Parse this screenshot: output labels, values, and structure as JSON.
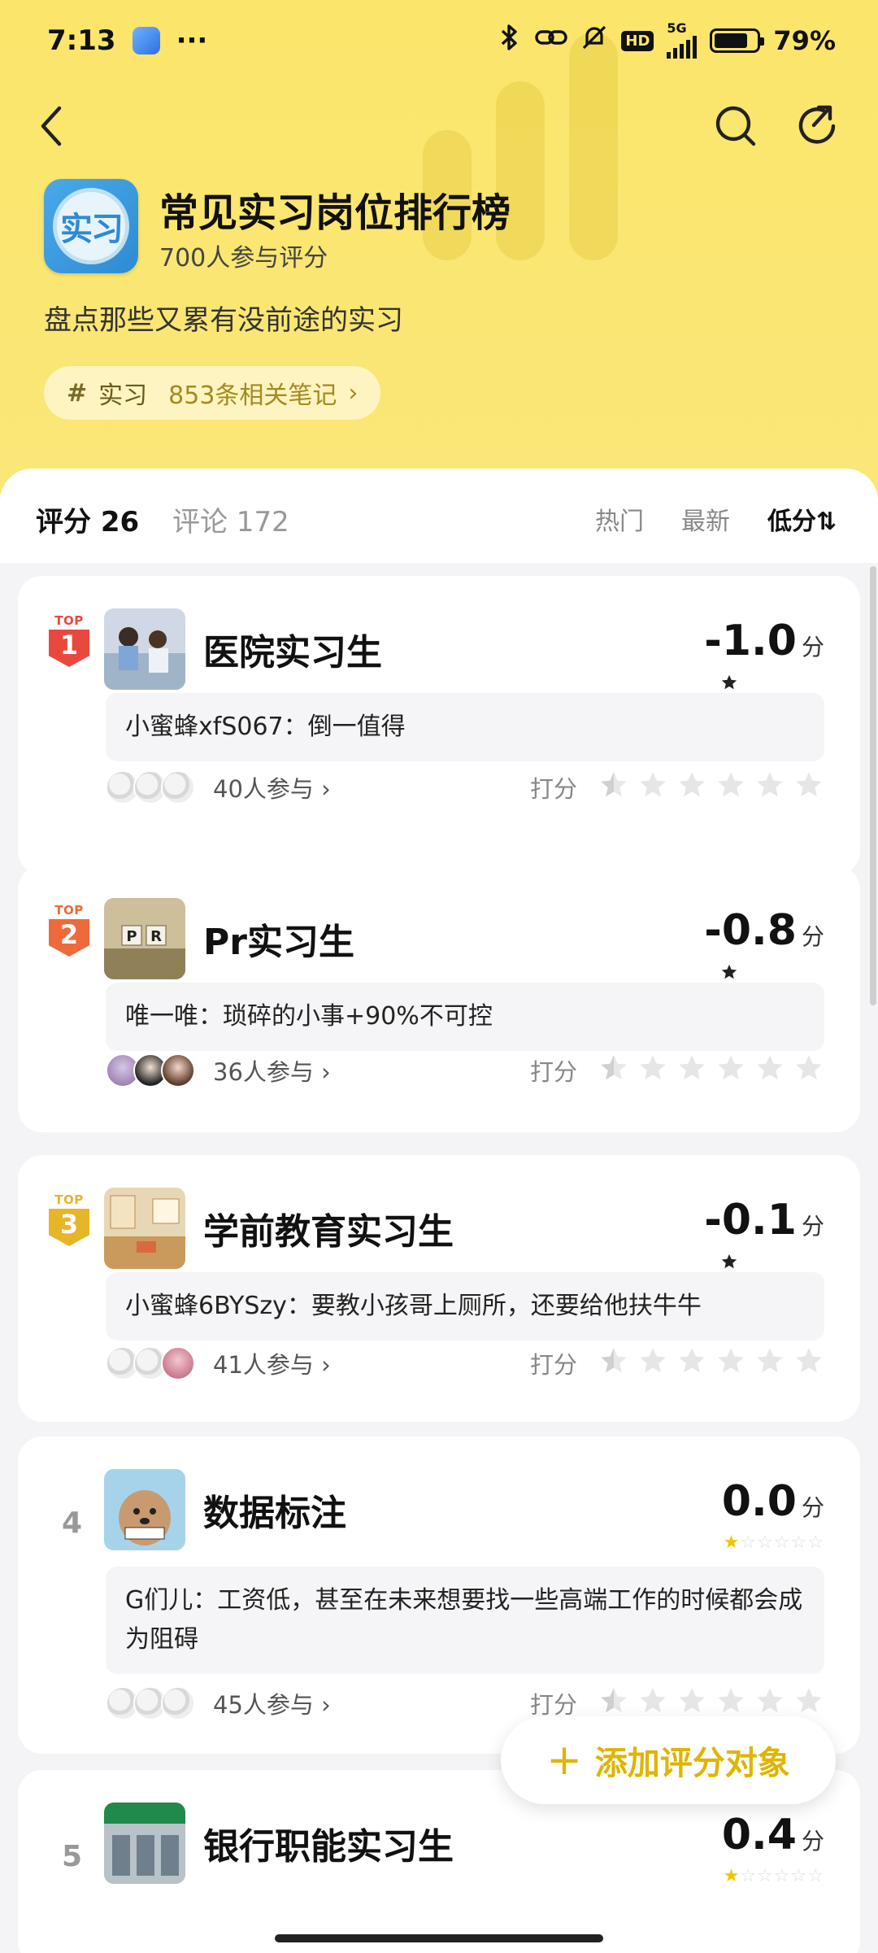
{
  "status_bar": {
    "time": "7:13",
    "dots": "···",
    "network": "5G",
    "hd": "HD",
    "battery": "79%",
    "battery_level": 0.79
  },
  "header": {
    "logo_text": "实习",
    "title": "常见实习岗位排行榜",
    "participants": "700人参与评分",
    "subtitle": "盘点那些又累有没前途的实习",
    "tag": {
      "hash": "#",
      "name": "实习",
      "count": "853条相关笔记",
      "chevron": "›"
    }
  },
  "tabs": {
    "rating": "评分 26",
    "comments": "评论 172"
  },
  "sort": {
    "hot": "热门",
    "newest": "最新",
    "low": "低分⇅"
  },
  "rank_top_label": "TOP",
  "score_unit": "分",
  "rate_label": "打分",
  "colors": {
    "accent": "#fae779",
    "top1": "#e8493f",
    "top2": "#ee6a3c",
    "top3": "#e6b52a",
    "fab": "#e0b400"
  },
  "items": [
    {
      "rank": "1",
      "name": "医院实习生",
      "score": "-1.0",
      "comment": "小蜜蜂xfS067：倒一值得",
      "participants": "40人参与 ›",
      "thumb": "hospital"
    },
    {
      "rank": "2",
      "name": "Pr实习生",
      "score": "-0.8",
      "comment": "唯一唯：琐碎的小事+90%不可控",
      "participants": "36人参与 ›",
      "thumb": "pr"
    },
    {
      "rank": "3",
      "name": "学前教育实习生",
      "score": "-0.1",
      "comment": "小蜜蜂6BYSzy：要教小孩哥上厕所，还要给他扶牛牛",
      "participants": "41人参与 ›",
      "thumb": "classroom"
    },
    {
      "rank": "4",
      "name": "数据标注",
      "score": "0.0",
      "comment": "G们儿：工资低，甚至在未来想要找一些高端工作的时候都会成为阻碍",
      "participants": "45人参与 ›",
      "thumb": "dog"
    },
    {
      "rank": "5",
      "name": "银行职能实习生",
      "score": "0.4",
      "comment": "",
      "participants": "",
      "thumb": "bank"
    }
  ],
  "fab": {
    "plus": "+",
    "label": "添加评分对象"
  }
}
